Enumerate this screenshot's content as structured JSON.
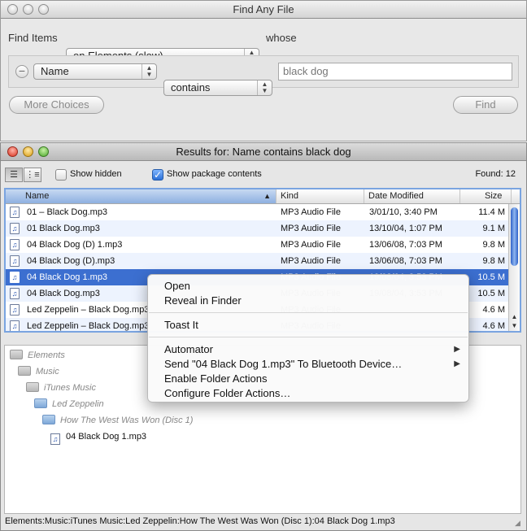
{
  "search_window": {
    "title": "Find Any File",
    "find_items_label": "Find Items",
    "location_popup": "on Elements (slow)",
    "whose_label": "whose",
    "criteria": {
      "attribute": "Name",
      "operator": "contains",
      "value": "black dog"
    },
    "more_choices": "More Choices",
    "find": "Find"
  },
  "results_window": {
    "title": "Results for: Name contains black dog",
    "show_hidden": "Show hidden",
    "show_package_contents": "Show package contents",
    "found": "Found: 12",
    "columns": [
      "Name",
      "Kind",
      "Date Modified",
      "Size"
    ],
    "rows": [
      {
        "name": "01 – Black Dog.mp3",
        "kind": "MP3 Audio File",
        "date": "3/01/10, 3:40 PM",
        "size": "11.4 M"
      },
      {
        "name": "01 Black Dog.mp3",
        "kind": "MP3 Audio File",
        "date": "13/10/04, 1:07 PM",
        "size": "9.1 M"
      },
      {
        "name": "04 Black Dog (D) 1.mp3",
        "kind": "MP3 Audio File",
        "date": "13/06/08, 7:03 PM",
        "size": "9.8 M"
      },
      {
        "name": "04 Black Dog (D).mp3",
        "kind": "MP3 Audio File",
        "date": "13/06/08, 7:03 PM",
        "size": "9.8 M"
      },
      {
        "name": "04 Black Dog 1.mp3",
        "kind": "MP3 Audio File",
        "date": "19/08/04, 3:53 PM",
        "size": "10.5 M"
      },
      {
        "name": "04 Black Dog.mp3",
        "kind": "MP3 Audio File",
        "date": "19/08/04, 3:53 PM",
        "size": "10.5 M"
      },
      {
        "name": "Led Zeppelin – Black Dog.mp3",
        "kind": "MP3 Audio File",
        "date": "",
        "size": "4.6 M"
      },
      {
        "name": "Led Zeppelin – Black Dog.mp3",
        "kind": "MP3 Audio File",
        "date": "",
        "size": "4.6 M"
      }
    ],
    "path": [
      "Elements",
      "Music",
      "iTunes Music",
      "Led Zeppelin",
      "How The West Was Won (Disc 1)",
      "04 Black Dog 1.mp3"
    ],
    "status": "Elements:Music:iTunes Music:Led Zeppelin:How The West Was Won (Disc 1):04 Black Dog 1.mp3"
  },
  "context_menu": {
    "open": "Open",
    "reveal": "Reveal in Finder",
    "toast": "Toast It",
    "automator": "Automator",
    "send_bluetooth": "Send \"04 Black Dog 1.mp3\" To Bluetooth Device…",
    "enable_folder_actions": "Enable Folder Actions",
    "configure_folder_actions": "Configure Folder Actions…"
  },
  "colors": {
    "selection": "#3c6fd0",
    "focus_ring": "#7aa4e0"
  }
}
